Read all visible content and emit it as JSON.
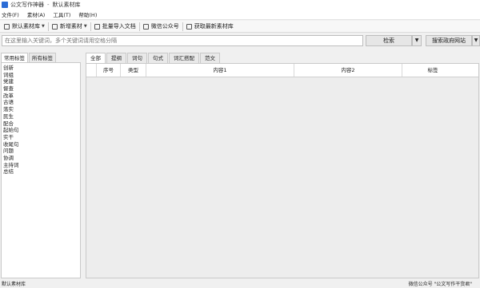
{
  "window": {
    "app_title": "公文写作神器",
    "separator": "-",
    "doc_title": "默认素材库"
  },
  "menu": [
    "文件(F)",
    "素材(A)",
    "工具(T)",
    "帮助(H)"
  ],
  "toolbar": {
    "default_library": "默认素材库",
    "new_material": "新增素材",
    "batch_import": "批量导入文档",
    "wechat_account": "微信公众号",
    "get_latest_library": "获取最新素材库"
  },
  "search": {
    "placeholder": "在这里输入关键词，多个关键词请用空格分隔",
    "search_button": "检索",
    "gov_search_button": "搜索政府网站"
  },
  "left_tabs": [
    "常用标签",
    "所有标签"
  ],
  "left_items": [
    "创新",
    "词组",
    "党建",
    "督查",
    "改革",
    "古语",
    "落实",
    "民生",
    "配合",
    "起始句",
    "实干",
    "收尾句",
    "问题",
    "协调",
    "主持词",
    "总结"
  ],
  "right_tabs": [
    "全部",
    "提纲",
    "词句",
    "句式",
    "词汇搭配",
    "范文"
  ],
  "grid_columns": [
    "序号",
    "类型",
    "内容1",
    "内容2",
    "标签"
  ],
  "status": {
    "left": "默认素材库",
    "right": "微信公众号 \"公文写作干货君\""
  }
}
